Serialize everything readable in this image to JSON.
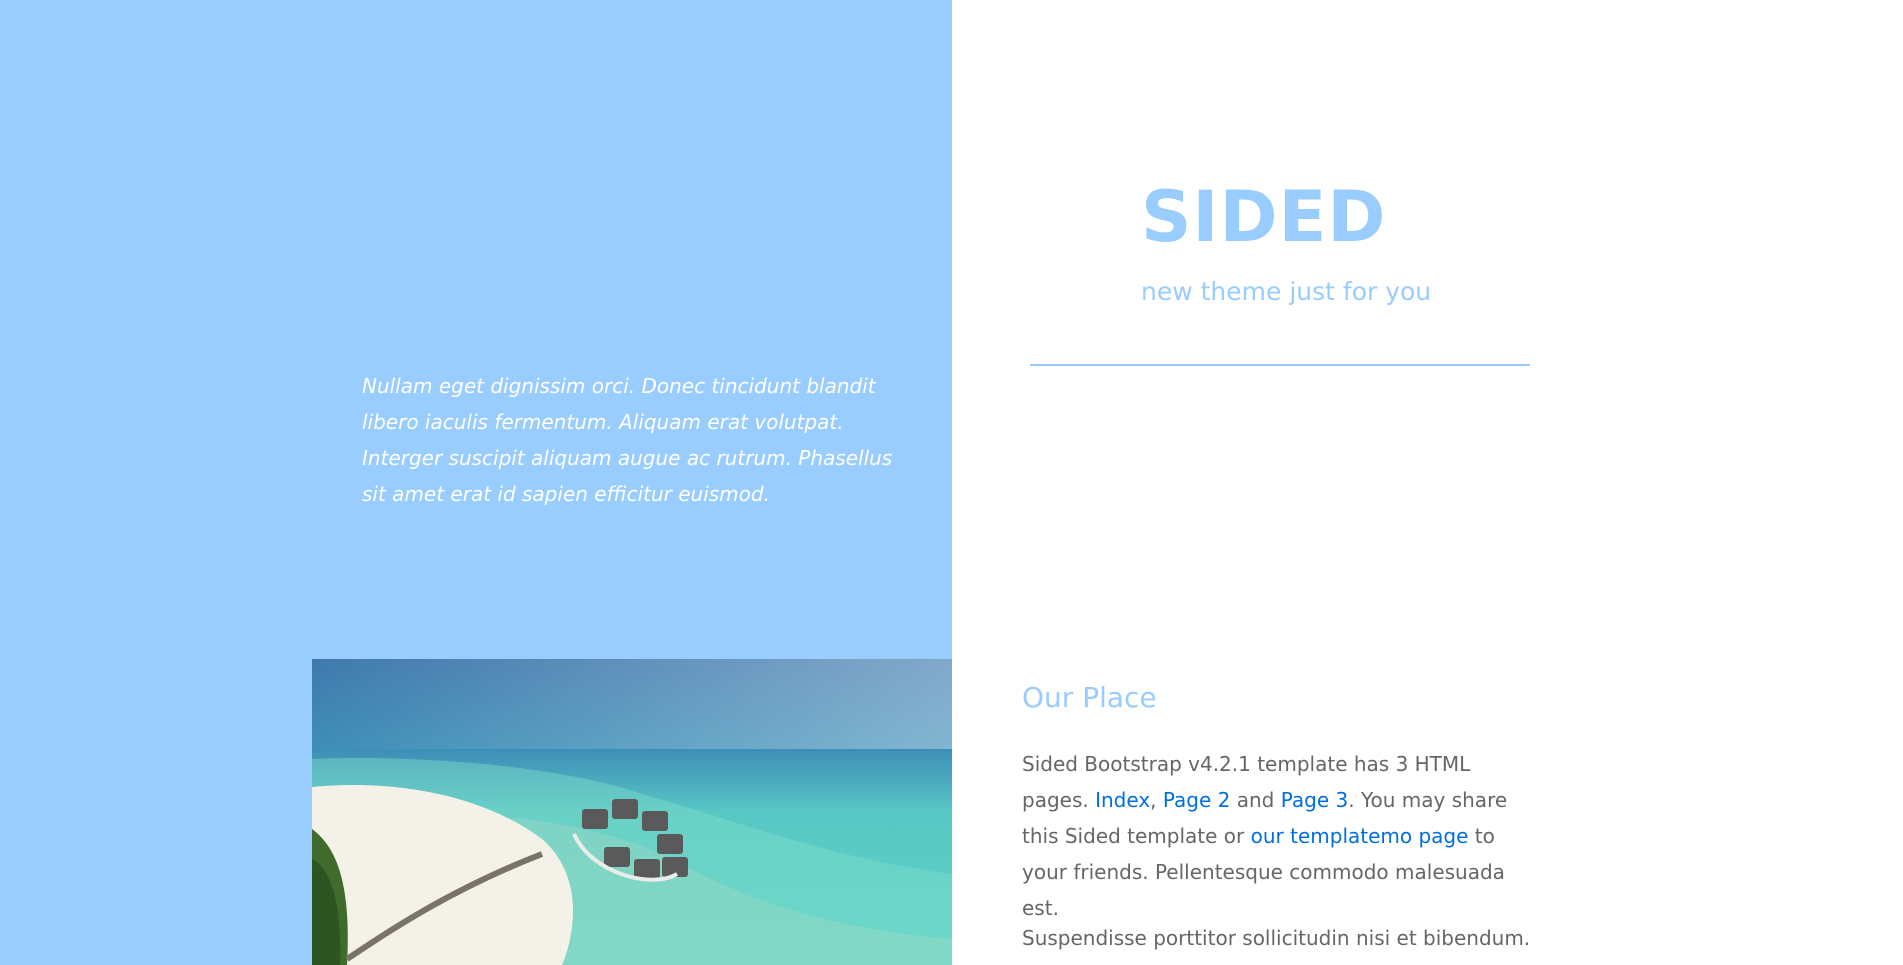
{
  "colors": {
    "accent": "#99ccff",
    "link": "#0070e0",
    "body_text": "#666666",
    "background": "#ffffff"
  },
  "left": {
    "quote": "Nullam eget dignissim orci. Donec tincidunt blandit libero iaculis fermentum. Aliquam erat volutpat. Interger suscipit aliquam augue ac rutrum. Phasellus sit amet erat id sapien efficitur euismod."
  },
  "hero": {
    "brand": "SIDED",
    "tagline": "new theme just for you"
  },
  "place": {
    "title": "Our Place",
    "intro_text": "Sided Bootstrap v4.2.1 template has 3 HTML pages.",
    "link_index": "Index",
    "comma": ",",
    "link_page2": "Page 2",
    "and_text": "and",
    "link_page3": "Page 3",
    "share_text": ". You may share this Sided template or",
    "link_templatemo": "our templatemo page",
    "friends_text": "to your friends. Pellentesque commodo malesuada est.",
    "para2": "Suspendisse porttitor sollicitudin nisi et bibendum."
  }
}
